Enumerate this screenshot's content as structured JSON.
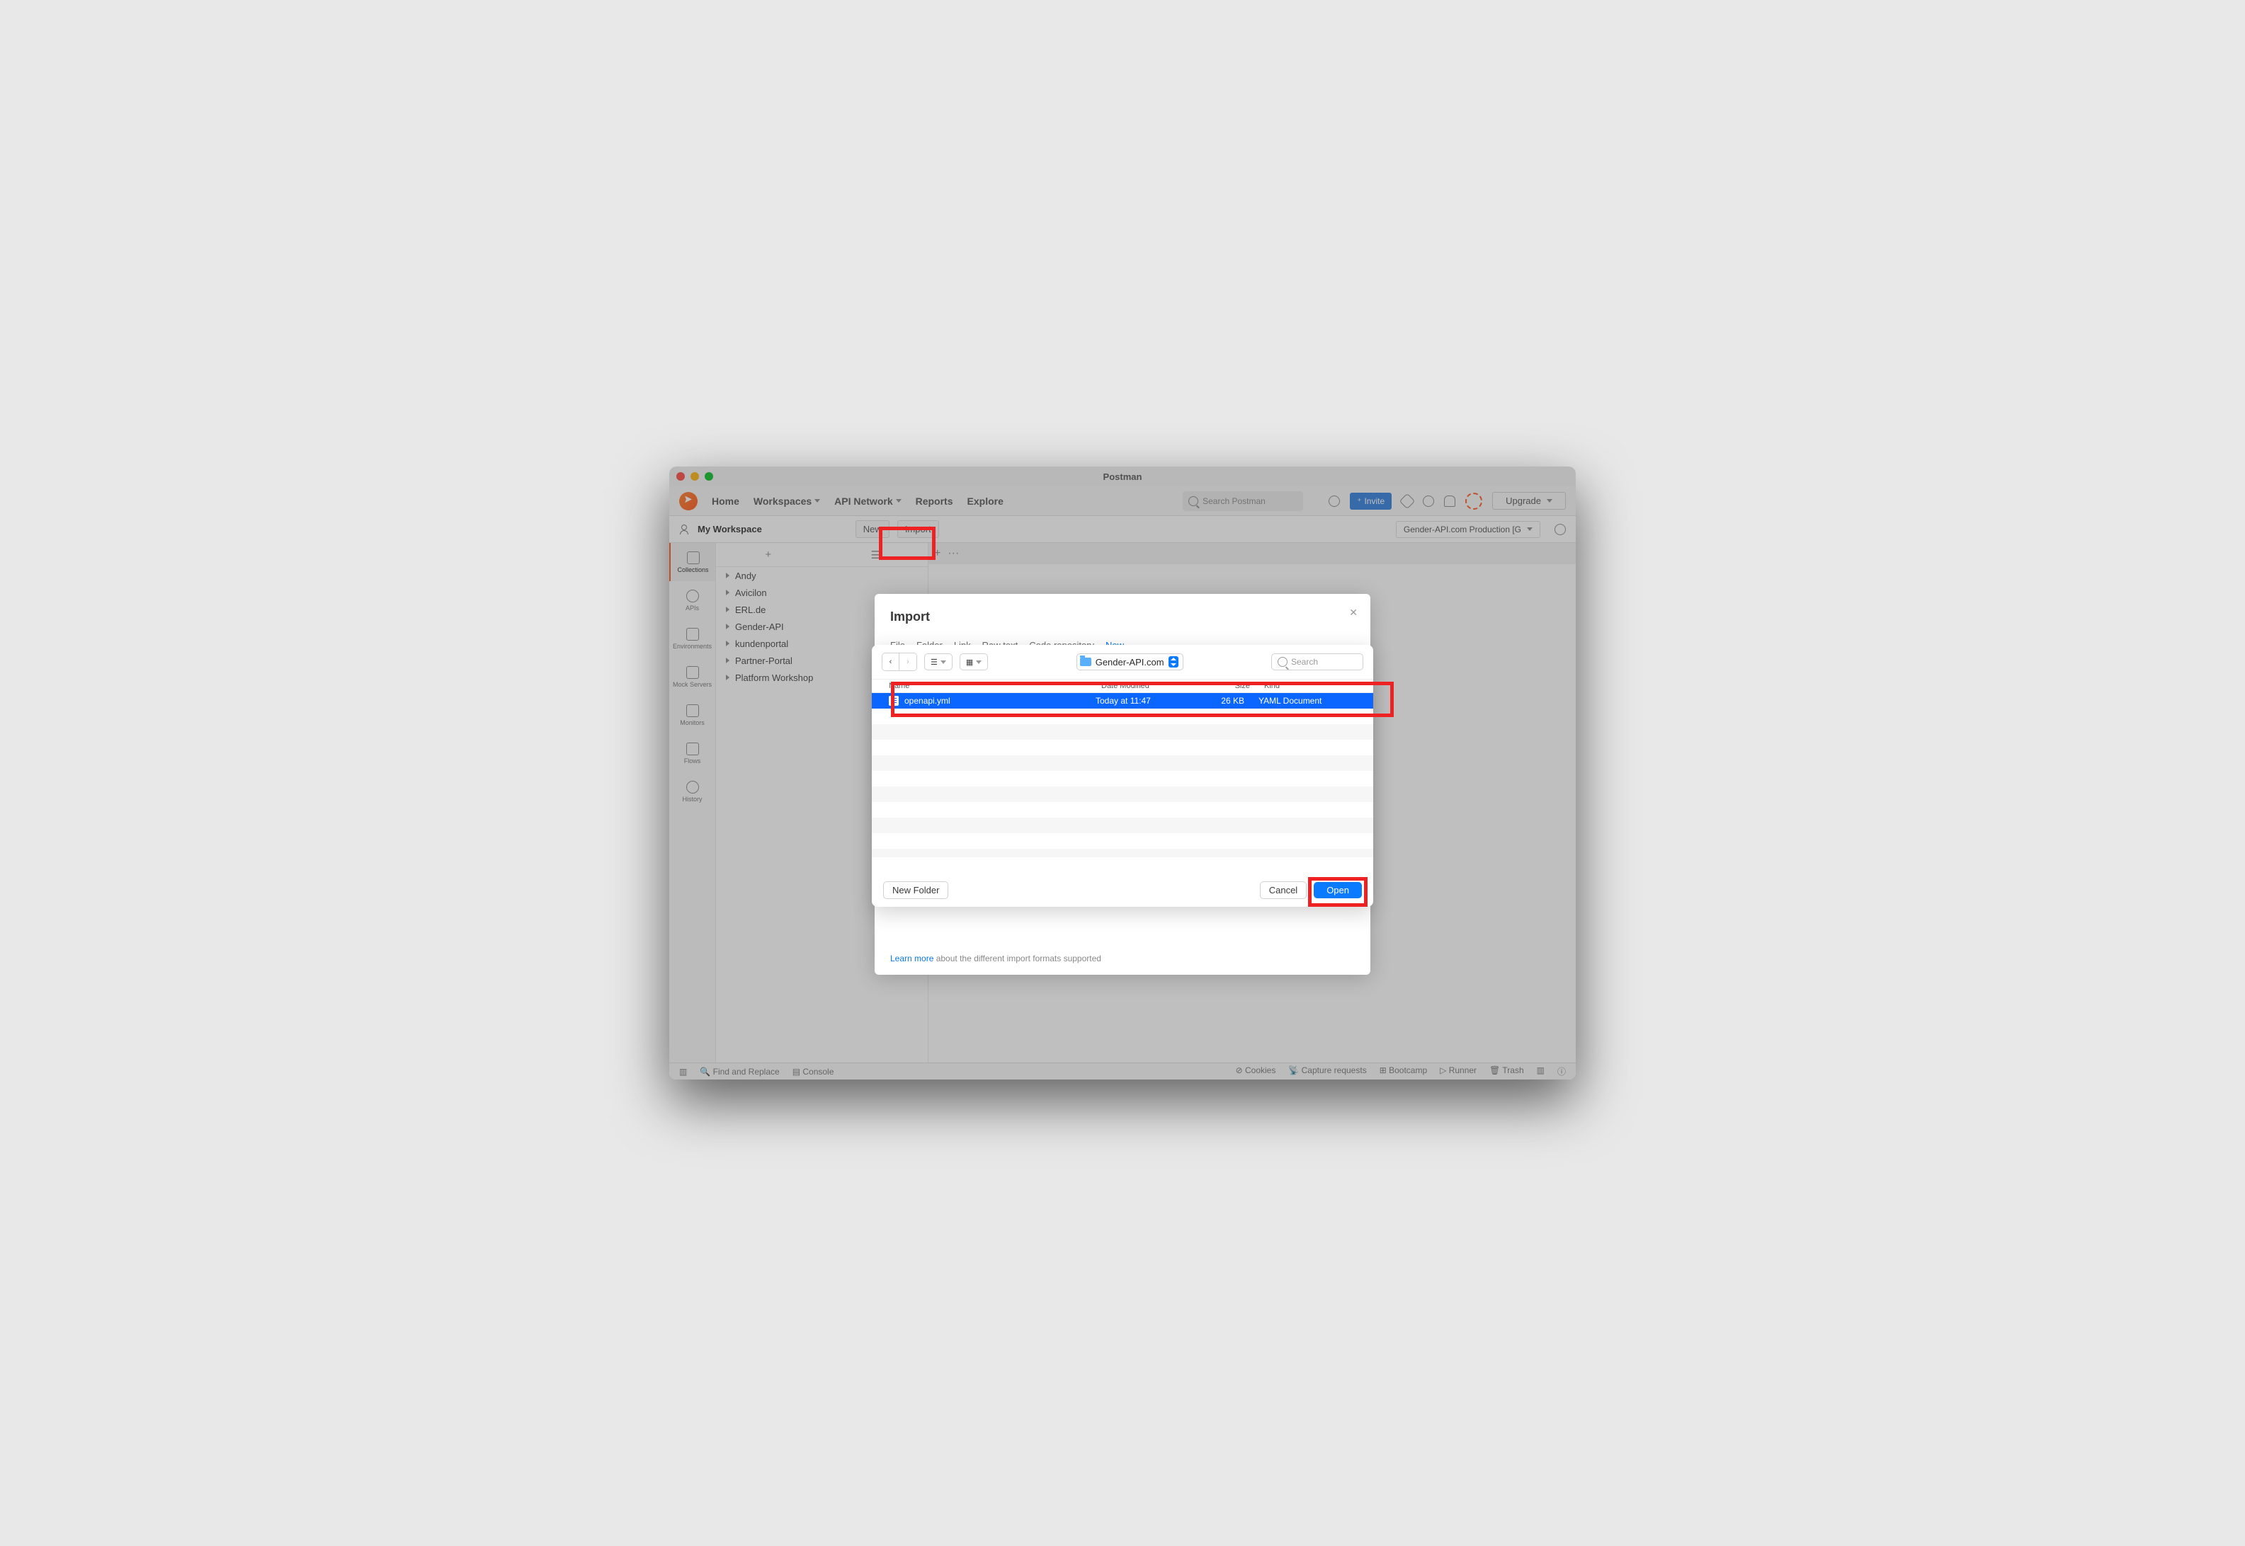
{
  "titlebar": {
    "title": "Postman"
  },
  "nav": {
    "home": "Home",
    "workspaces": "Workspaces",
    "api_network": "API Network",
    "reports": "Reports",
    "explore": "Explore",
    "search_placeholder": "Search Postman",
    "invite": "Invite",
    "upgrade": "Upgrade"
  },
  "workspace": {
    "name": "My Workspace",
    "new_btn": "New",
    "import_btn": "Import",
    "environment": "Gender-API.com Production [G"
  },
  "rail": {
    "collections": "Collections",
    "apis": "APIs",
    "environments": "Environments",
    "mock_servers": "Mock Servers",
    "monitors": "Monitors",
    "flows": "Flows",
    "history": "History"
  },
  "tree": {
    "items": [
      {
        "label": "Andy"
      },
      {
        "label": "Avicilon"
      },
      {
        "label": "ERL.de"
      },
      {
        "label": "Gender-API"
      },
      {
        "label": "kundenportal"
      },
      {
        "label": "Partner-Portal"
      },
      {
        "label": "Platform Workshop"
      }
    ]
  },
  "modal": {
    "title": "Import",
    "tabs": {
      "file": "File",
      "folder": "Folder",
      "link": "Link",
      "raw": "Raw text",
      "repo": "Code repository",
      "new": "New"
    },
    "learn_link": "Learn more",
    "learn_text": " about the different import formats supported"
  },
  "picker": {
    "location": "Gender-API.com",
    "search_placeholder": "Search",
    "cols": {
      "name": "Name",
      "modified": "Date Modified",
      "size": "Size",
      "kind": "Kind"
    },
    "row": {
      "name": "openapi.yml",
      "modified": "Today at 11:47",
      "size": "26 KB",
      "kind": "YAML Document"
    },
    "new_folder": "New Folder",
    "cancel": "Cancel",
    "open": "Open"
  },
  "statusbar": {
    "find": "Find and Replace",
    "console": "Console",
    "cookies": "Cookies",
    "capture": "Capture requests",
    "bootcamp": "Bootcamp",
    "runner": "Runner",
    "trash": "Trash"
  }
}
